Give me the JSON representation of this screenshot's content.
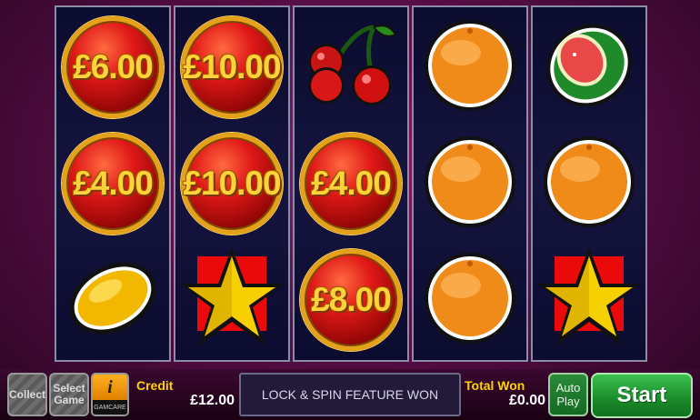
{
  "reels": [
    [
      {
        "kind": "prize",
        "label": "£6.00"
      },
      {
        "kind": "prize",
        "label": "£4.00"
      },
      {
        "kind": "lemon",
        "icon": "lemon-icon"
      }
    ],
    [
      {
        "kind": "prize",
        "label": "£10.00"
      },
      {
        "kind": "prize",
        "label": "£10.00"
      },
      {
        "kind": "star",
        "icon": "star-icon"
      }
    ],
    [
      {
        "kind": "cherries",
        "icon": "cherries-icon"
      },
      {
        "kind": "prize",
        "label": "£4.00"
      },
      {
        "kind": "prize",
        "label": "£8.00"
      }
    ],
    [
      {
        "kind": "orange",
        "icon": "orange-icon"
      },
      {
        "kind": "orange",
        "icon": "orange-icon"
      },
      {
        "kind": "orange",
        "icon": "orange-icon"
      }
    ],
    [
      {
        "kind": "watermelon",
        "icon": "watermelon-icon"
      },
      {
        "kind": "orange",
        "icon": "orange-icon"
      },
      {
        "kind": "star",
        "icon": "star-icon"
      }
    ]
  ],
  "controls": {
    "collect_label": "Collect",
    "select_game_label": "Select Game",
    "info_icon": "info-icon",
    "info_brand": "GAMCARE",
    "credit_label": "Credit",
    "credit_value": "£12.00",
    "message": "LOCK & SPIN FEATURE WON",
    "total_won_label": "Total Won",
    "total_won_value": "£0.00",
    "auto_play_label": "Auto Play",
    "start_label": "Start"
  },
  "colors": {
    "background": "#5a0e48",
    "reel_background": "#14143e",
    "prize_gold": "#ffd23a",
    "start_green": "#1a8a2a"
  }
}
